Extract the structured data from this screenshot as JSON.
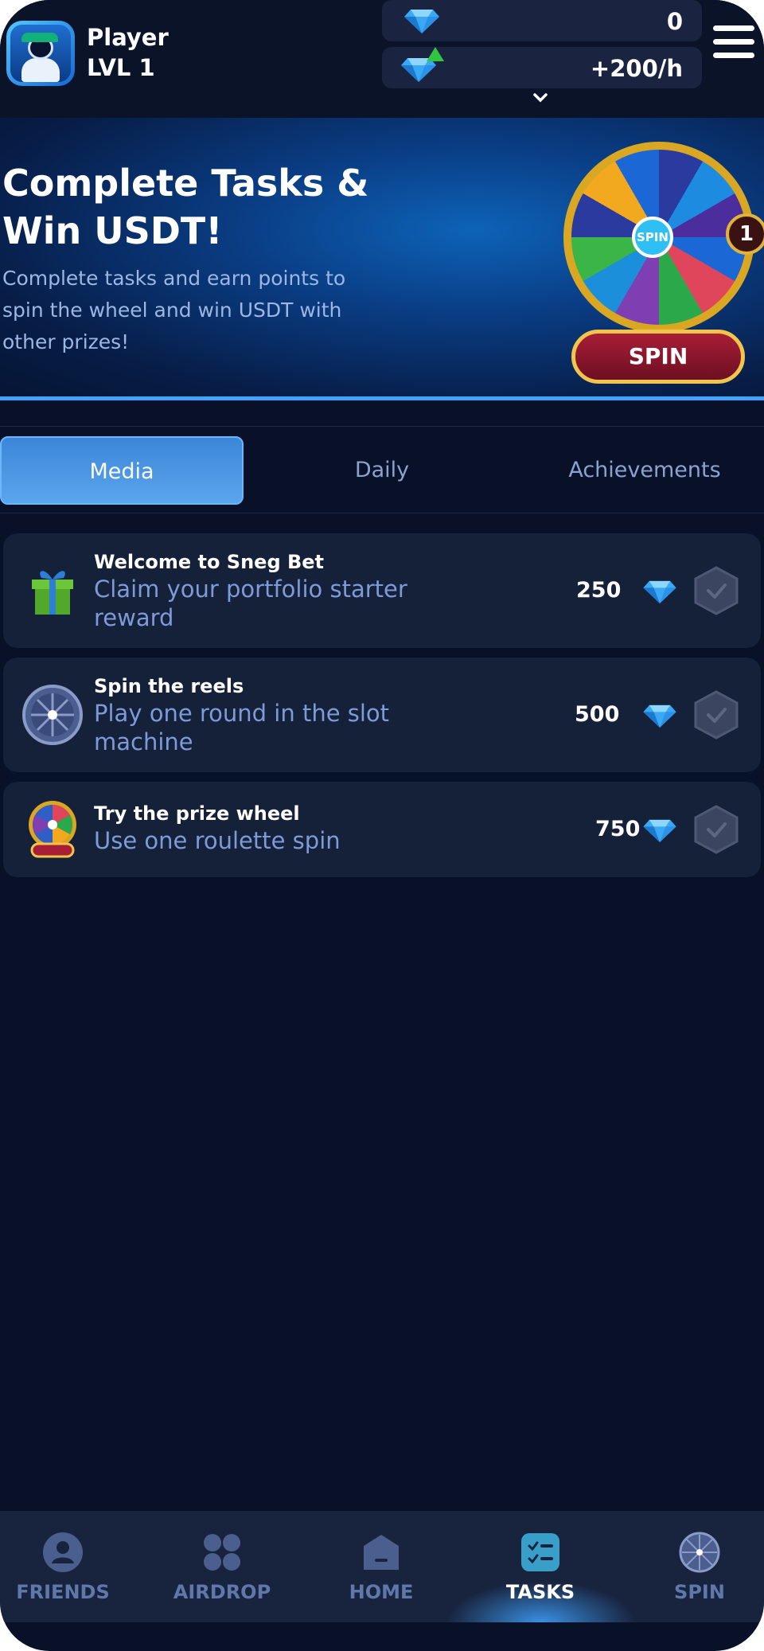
{
  "header": {
    "player_name": "Player",
    "player_level": "LVL 1",
    "gems_value": "0",
    "rate_value": "+200/h",
    "icons": [
      "avatar",
      "gem-icon",
      "gem-boost-icon",
      "chevron-down-icon",
      "hamburger-menu-icon"
    ]
  },
  "banner": {
    "title": "Complete Tasks & Win USDT!",
    "description": "Complete tasks and earn points to spin the wheel and win USDT with other prizes!",
    "wheel_center_label": "SPIN",
    "wheel_badge_count": "1",
    "spin_button_label": "SPIN"
  },
  "tabs": [
    {
      "label": "Media",
      "active": true
    },
    {
      "label": "Daily",
      "active": false
    },
    {
      "label": "Achievements",
      "active": false
    }
  ],
  "tasks": [
    {
      "title": "Welcome to Sneg Bet",
      "description": "Claim your portfolio starter reward",
      "points": "250",
      "icon": "gift-icon",
      "completed": false
    },
    {
      "title": "Spin the reels",
      "description": "Play one round in the slot machine",
      "points": "500",
      "icon": "reel-wheel-icon",
      "completed": false
    },
    {
      "title": "Try the prize wheel",
      "description": "Use one roulette spin",
      "points": "750",
      "icon": "prize-wheel-icon",
      "completed": false
    }
  ],
  "bottom_nav": [
    {
      "label": "FRIENDS",
      "icon": "friends-icon",
      "active": false
    },
    {
      "label": "AIRDROP",
      "icon": "airdrop-icon",
      "active": false
    },
    {
      "label": "HOME",
      "icon": "home-icon",
      "active": false
    },
    {
      "label": "TASKS",
      "icon": "tasks-icon",
      "active": true
    },
    {
      "label": "SPIN",
      "icon": "spin-icon",
      "active": false
    }
  ],
  "colors": {
    "background": "#081127",
    "accent": "#3fa4ff",
    "active_tab": "#4a96e2",
    "muted_text": "#7d9ad9"
  }
}
